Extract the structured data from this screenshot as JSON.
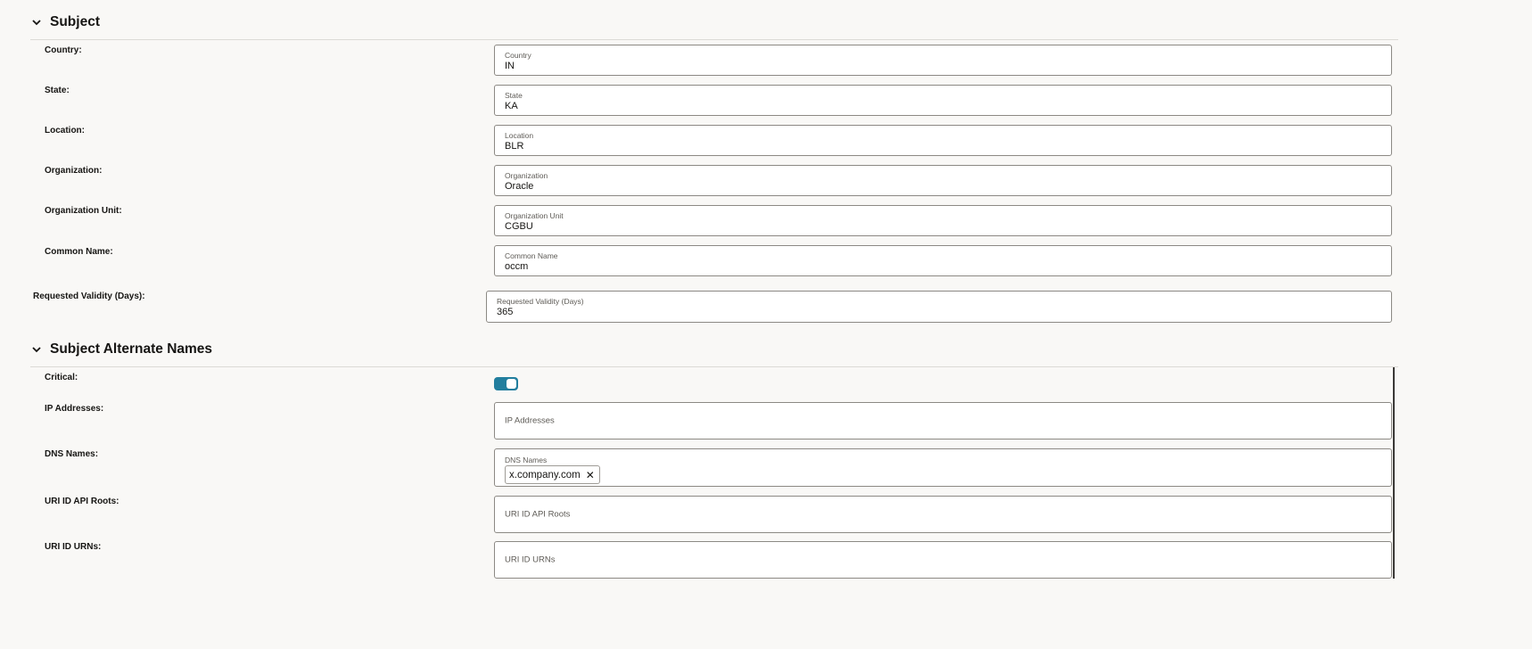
{
  "subject": {
    "title": "Subject",
    "fields": [
      {
        "label": "Country:",
        "float_label": "Country",
        "value": "IN"
      },
      {
        "label": "State:",
        "float_label": "State",
        "value": "KA"
      },
      {
        "label": "Location:",
        "float_label": "Location",
        "value": "BLR"
      },
      {
        "label": "Organization:",
        "float_label": "Organization",
        "value": "Oracle"
      },
      {
        "label": "Organization Unit:",
        "float_label": "Organization Unit",
        "value": "CGBU"
      },
      {
        "label": "Common Name:",
        "float_label": "Common Name",
        "value": "occm"
      }
    ]
  },
  "validity": {
    "label": "Requested Validity (Days):",
    "float_label": "Requested Validity (Days)",
    "value": "365"
  },
  "san": {
    "title": "Subject Alternate Names",
    "critical": {
      "label": "Critical:",
      "enabled": true
    },
    "ip": {
      "label": "IP Addresses:",
      "placeholder": "IP Addresses"
    },
    "dns": {
      "label": "DNS Names:",
      "float_label": "DNS Names",
      "chips": [
        "x.company.com"
      ]
    },
    "uri_api": {
      "label": "URI ID API Roots:",
      "placeholder": "URI ID API Roots"
    },
    "uri_urn": {
      "label": "URI ID URNs:",
      "placeholder": "URI ID URNs"
    }
  },
  "colors": {
    "toggle_on": "#227e9e",
    "background": "#f9f8f6"
  }
}
